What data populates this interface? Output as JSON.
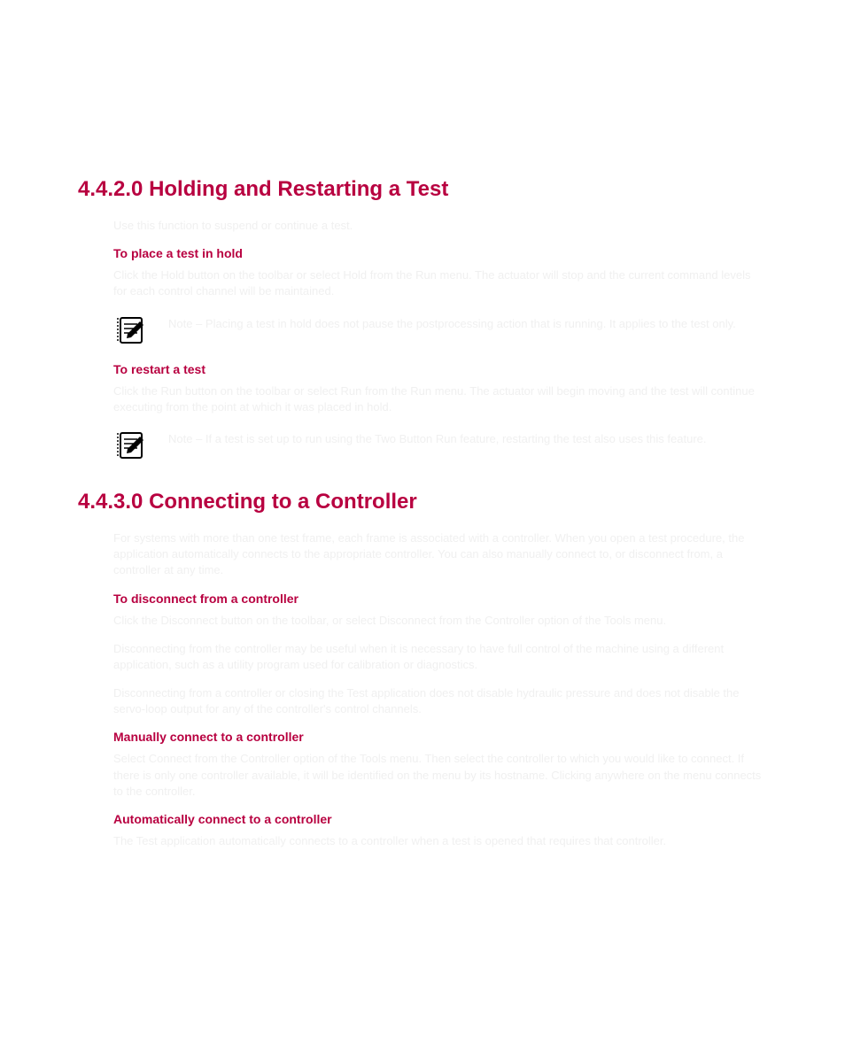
{
  "sec1": {
    "heading": "4.4.2.0 Holding and Restarting a Test",
    "intro": "Use this function to suspend or continue a test.",
    "hold": {
      "title": "To place a test in hold",
      "body": "Click the Hold button on the toolbar or select Hold from the Run menu. The actuator will stop and the current command levels for each control channel will be maintained.",
      "note": "Note – Placing a test in hold does not pause the postprocessing action that is running. It applies to the test only."
    },
    "restart": {
      "title": "To restart a test",
      "body": "Click the Run button on the toolbar or select Run from the Run menu. The actuator will begin moving and the test will continue executing from the point at which it was placed in hold.",
      "note": "Note – If a test is set up to run using the Two Button Run feature, restarting the test also uses this feature."
    }
  },
  "sec2": {
    "heading": "4.4.3.0 Connecting to a Controller",
    "intro": "For systems with more than one test frame, each frame is associated with a controller. When you open a test procedure, the application automatically connects to the appropriate controller. You can also manually connect to, or disconnect from, a controller at any time.",
    "disconnect": {
      "title": "To disconnect from a controller",
      "body1": "Click the Disconnect button on the toolbar, or select Disconnect from the Controller option of the Tools menu.",
      "body2": "Disconnecting from the controller may be useful when it is necessary to have full control of the machine using a different application, such as a utility program used for calibration or diagnostics.",
      "body3": "Disconnecting from a controller or closing the Test application does not disable hydraulic pressure and does not disable the servo-loop output for any of the controller's control channels."
    },
    "manual": {
      "title": "Manually connect to a controller",
      "body": "Select Connect from the Controller option of the Tools menu. Then select the controller to which you would like to connect. If there is only one controller available, it will be identified on the menu by its hostname. Clicking anywhere on the menu connects to the controller."
    },
    "auto": {
      "title": "Automatically connect to a controller",
      "body": "The Test application automatically connects to a controller when a test is opened that requires that controller."
    }
  }
}
